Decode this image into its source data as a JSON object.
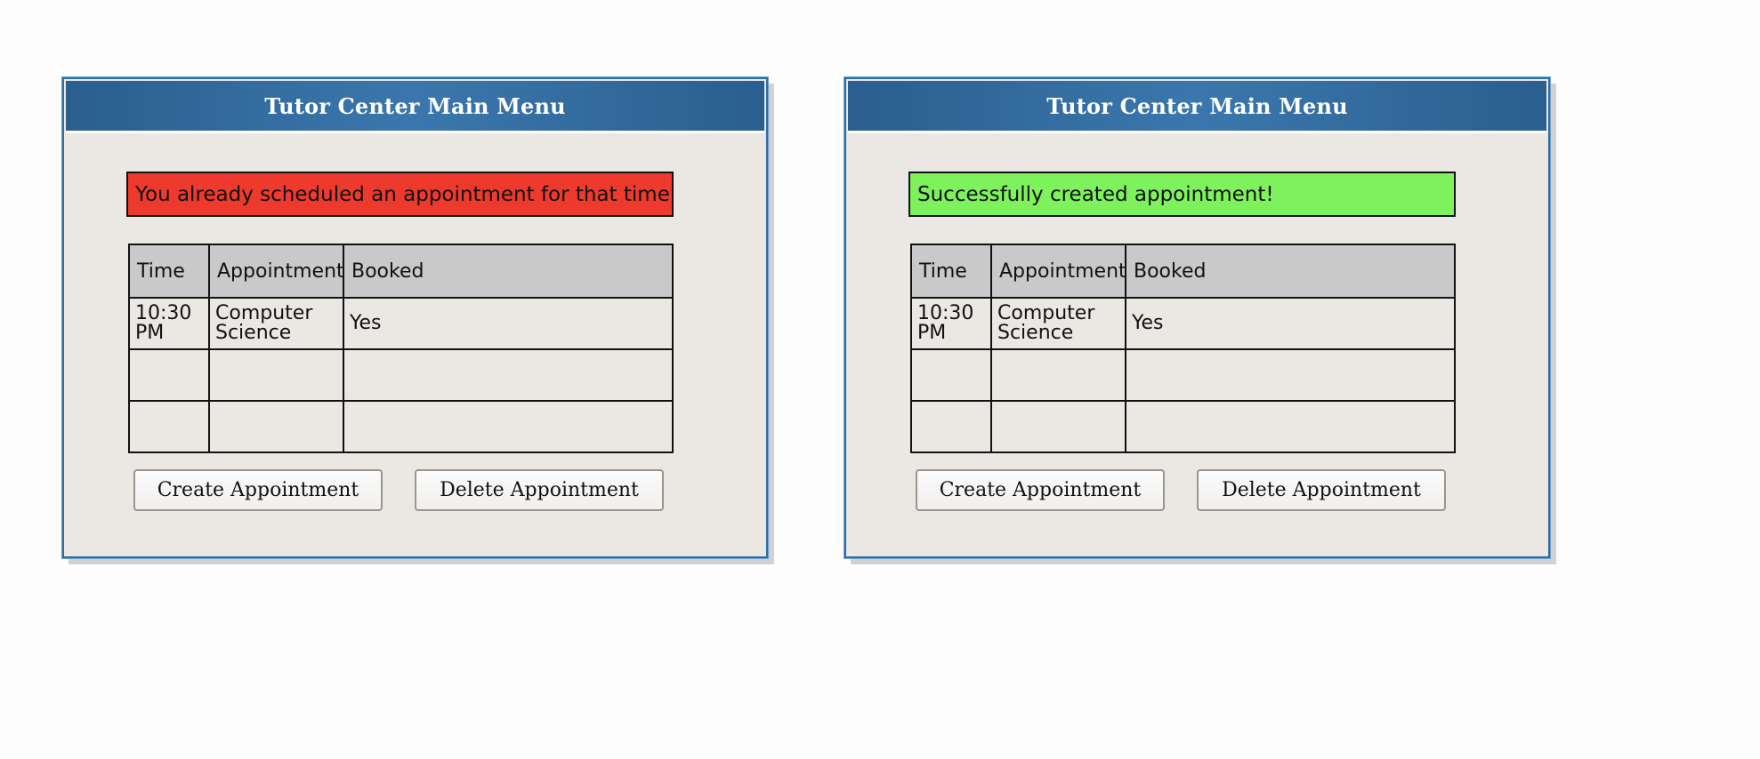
{
  "windows": [
    {
      "title": "Tutor Center Main Menu",
      "message": {
        "text": "You already scheduled an appointment for that time!",
        "status": "error",
        "color": "#ee3a2c"
      },
      "table": {
        "headers": [
          "Time",
          "Appointment",
          "Booked"
        ],
        "rows": [
          [
            "10:30 PM",
            "Computer Science",
            "Yes"
          ],
          [
            "",
            "",
            ""
          ],
          [
            "",
            "",
            ""
          ]
        ]
      },
      "buttons": {
        "create": "Create Appointment",
        "delete": "Delete Appointment"
      }
    },
    {
      "title": "Tutor Center Main Menu",
      "message": {
        "text": "Successfully created appointment!",
        "status": "success",
        "color": "#7ef25c"
      },
      "table": {
        "headers": [
          "Time",
          "Appointment",
          "Booked"
        ],
        "rows": [
          [
            "10:30 PM",
            "Computer Science",
            "Yes"
          ],
          [
            "",
            "",
            ""
          ],
          [
            "",
            "",
            ""
          ]
        ]
      },
      "buttons": {
        "create": "Create Appointment",
        "delete": "Delete Appointment"
      }
    }
  ],
  "colors": {
    "titlebar": "#2e6ea6",
    "window_bg": "#ebe8e4",
    "header_row_bg": "#c9c9c9"
  }
}
